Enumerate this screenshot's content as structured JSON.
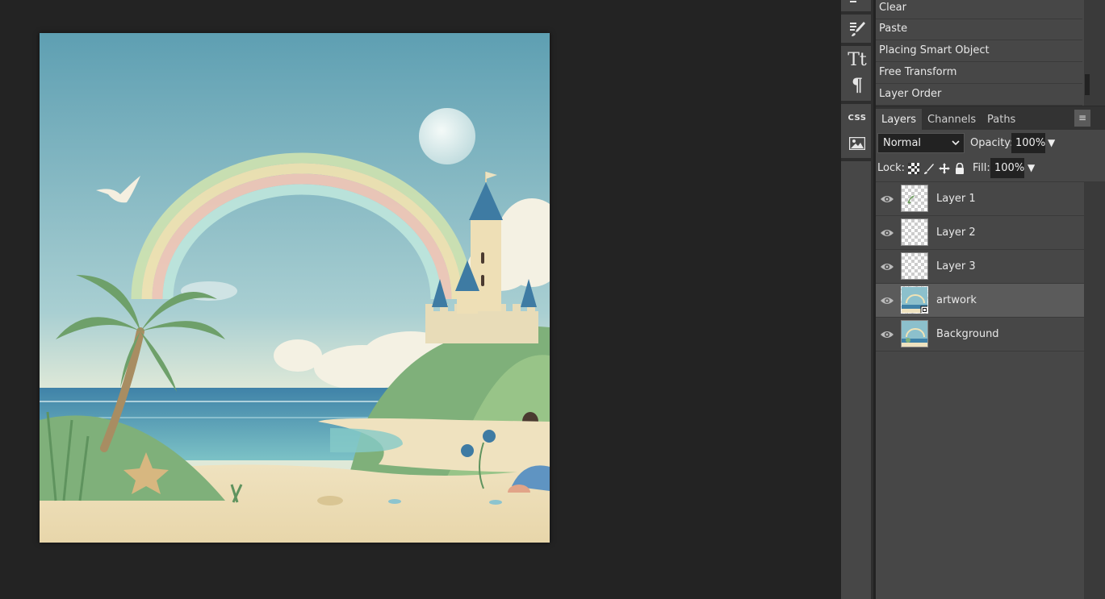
{
  "history": {
    "items": [
      {
        "label": "Clear"
      },
      {
        "label": "Paste"
      },
      {
        "label": "Placing Smart Object"
      },
      {
        "label": "Free Transform"
      },
      {
        "label": "Layer Order"
      }
    ]
  },
  "toolstrip": {
    "tools": [
      {
        "icon": "history-icon"
      },
      {
        "icon": "brush-settings-icon"
      },
      {
        "icon": "character-icon",
        "glyph": "Tt"
      },
      {
        "icon": "paragraph-icon",
        "glyph": "¶"
      },
      {
        "icon": "css-icon",
        "glyph": "CSS"
      },
      {
        "icon": "image-icon"
      }
    ]
  },
  "panel": {
    "tabs": [
      {
        "label": "Layers",
        "active": true
      },
      {
        "label": "Channels",
        "active": false
      },
      {
        "label": "Paths",
        "active": false
      }
    ],
    "menu_glyph": "≡",
    "blend_mode": "Normal",
    "opacity_label": "Opacity:",
    "opacity_value": "100%",
    "lock_label": "Lock:",
    "fill_label": "Fill:",
    "fill_value": "100%",
    "dropdown_glyph": "▼"
  },
  "layers": [
    {
      "name": "Layer 1",
      "thumb": "transparent-sprig",
      "selected": false
    },
    {
      "name": "Layer 2",
      "thumb": "transparent",
      "selected": false
    },
    {
      "name": "Layer 3",
      "thumb": "transparent",
      "selected": false
    },
    {
      "name": "artwork",
      "thumb": "artwork-smart-object",
      "selected": true
    },
    {
      "name": "Background",
      "thumb": "artwork",
      "selected": false
    }
  ],
  "colors": {
    "workspace": "#232323",
    "panel": "#474747",
    "selected_layer": "#5b5b5b"
  }
}
